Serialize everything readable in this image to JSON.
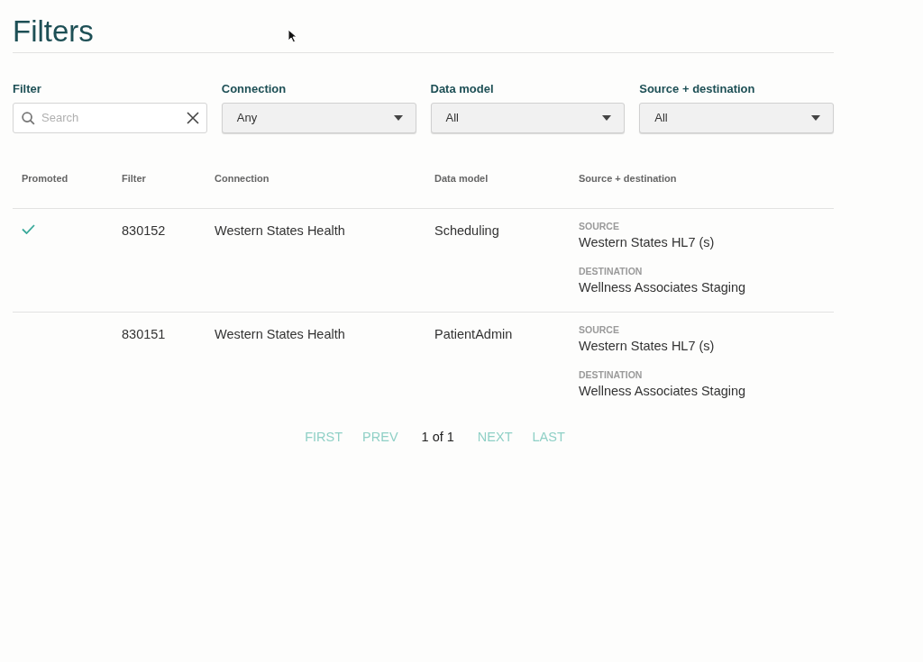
{
  "title": "Filters",
  "filters": [
    {
      "kind": "search",
      "label": "Filter",
      "placeholder": "Search"
    },
    {
      "kind": "select",
      "label": "Connection",
      "value": "Any"
    },
    {
      "kind": "select",
      "label": "Data model",
      "value": "All"
    },
    {
      "kind": "select",
      "label": "Source + destination",
      "value": "All"
    }
  ],
  "table": {
    "columns": [
      "Promoted",
      "Filter",
      "Connection",
      "Data model",
      "Source + destination"
    ],
    "rows": [
      {
        "promoted": true,
        "filter": "830152",
        "connection": "Western States Health",
        "data_model": "Scheduling",
        "source_label": "SOURCE",
        "source": "Western States HL7 (s)",
        "destination_label": "DESTINATION",
        "destination": "Wellness Associates Staging"
      },
      {
        "promoted": false,
        "filter": "830151",
        "connection": "Western States Health",
        "data_model": "PatientAdmin",
        "source_label": "SOURCE",
        "source": "Western States HL7 (s)",
        "destination_label": "DESTINATION",
        "destination": "Wellness Associates Staging"
      }
    ]
  },
  "pagination": [
    {
      "kind": "link",
      "label": "FIRST",
      "disabled": true
    },
    {
      "kind": "link",
      "label": "PREV",
      "disabled": true
    },
    {
      "kind": "status",
      "label": "1 of 1"
    },
    {
      "kind": "link",
      "label": "NEXT",
      "disabled": true
    },
    {
      "kind": "link",
      "label": "LAST",
      "disabled": true
    }
  ]
}
